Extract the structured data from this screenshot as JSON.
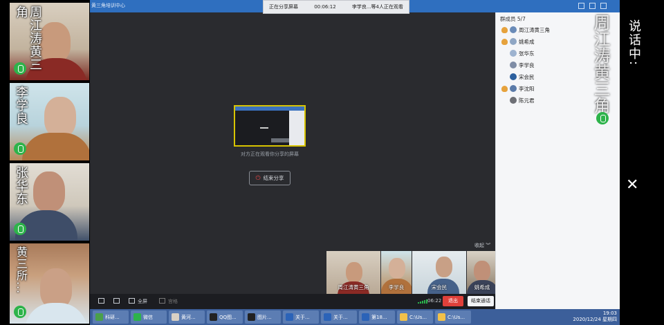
{
  "left_videos": [
    {
      "name": "周江涛黄三角"
    },
    {
      "name": "李学良"
    },
    {
      "name": "张华东"
    },
    {
      "name": "黄三所..."
    }
  ],
  "share_bar": {
    "status": "正在分享屏幕",
    "duration": "00:06:12",
    "viewers": "李学良...等4人正在观看"
  },
  "app_title": "黄三角培训中心",
  "preview_caption": "对方正在观看你分享的屏幕",
  "end_share_label": "结束分享",
  "collapse_label": "收起",
  "thumbnails": [
    {
      "name": "周江涛黄三角"
    },
    {
      "name": "李学良"
    },
    {
      "name": "宋会民"
    },
    {
      "name": "姚希成"
    }
  ],
  "controls": {
    "fullscreen_label": "全屏",
    "gallery_label": "宫格",
    "call_time": "06:22",
    "exit_label": "退出",
    "end_call_label": "结束通话"
  },
  "members_panel": {
    "title": "群成员 5/7",
    "members": [
      {
        "name": "周江涛黄三角"
      },
      {
        "name": "姚希成"
      },
      {
        "name": "张华东"
      },
      {
        "name": "李学良"
      },
      {
        "name": "宋会民"
      },
      {
        "name": "李沈阳"
      },
      {
        "name": "陈元君"
      }
    ]
  },
  "taskbar": {
    "items": [
      {
        "label": "科研..."
      },
      {
        "label": "微信"
      },
      {
        "label": "黄河..."
      },
      {
        "label": "QQ图..."
      },
      {
        "label": "图片..."
      },
      {
        "label": "关于..."
      },
      {
        "label": "关于..."
      },
      {
        "label": "第18..."
      },
      {
        "label": "C:\\Us..."
      },
      {
        "label": "C:\\Us..."
      }
    ],
    "time": "19:03",
    "date": "2020/12/24 星期四"
  },
  "overlay": {
    "speaking_label": "说话中:",
    "speaker_name": "周江涛黄三角",
    "close_symbol": "✕"
  },
  "colors": {
    "talk_green": "#2db34a",
    "exit_red": "#e0403a",
    "title_blue": "#2f6fbf",
    "preview_border": "#d8c400"
  }
}
